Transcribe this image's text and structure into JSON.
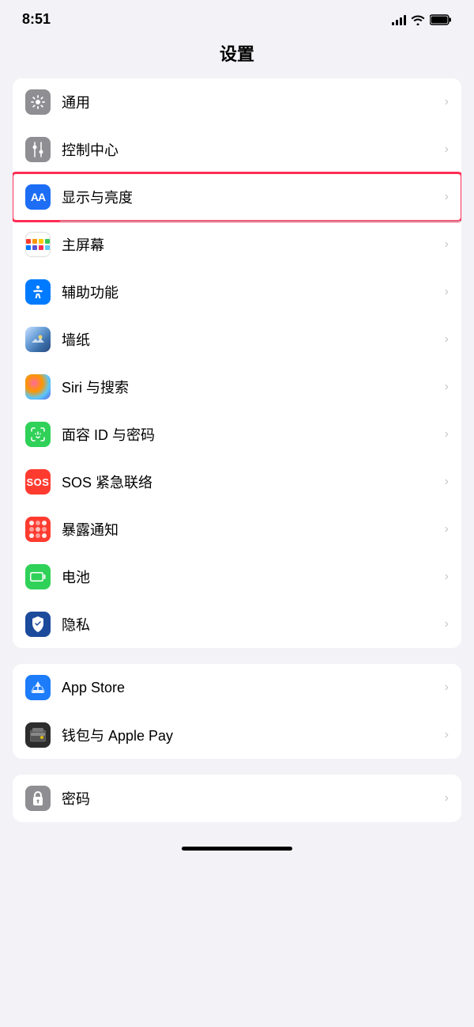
{
  "status": {
    "time": "8:51",
    "signal": "signal",
    "wifi": "wifi",
    "battery": "battery"
  },
  "page": {
    "title": "设置"
  },
  "group1": {
    "items": [
      {
        "id": "general",
        "label": "通用",
        "icon_type": "gray",
        "icon_symbol": "⚙",
        "highlighted": false
      },
      {
        "id": "control-center",
        "label": "控制中心",
        "icon_type": "gray-toggle",
        "icon_symbol": "toggle",
        "highlighted": false
      },
      {
        "id": "display",
        "label": "显示与亮度",
        "icon_type": "blue-aa",
        "icon_symbol": "AA",
        "highlighted": true
      },
      {
        "id": "home-screen",
        "label": "主屏幕",
        "icon_type": "colorful",
        "icon_symbol": "",
        "highlighted": false
      },
      {
        "id": "accessibility",
        "label": "辅助功能",
        "icon_type": "blue",
        "icon_symbol": "♿",
        "highlighted": false
      },
      {
        "id": "wallpaper",
        "label": "墙纸",
        "icon_type": "wallpaper",
        "icon_symbol": "✿",
        "highlighted": false
      },
      {
        "id": "siri",
        "label": "Siri 与搜索",
        "icon_type": "siri",
        "icon_symbol": "",
        "highlighted": false
      },
      {
        "id": "faceid",
        "label": "面容 ID 与密码",
        "icon_type": "faceid",
        "icon_symbol": "",
        "highlighted": false
      },
      {
        "id": "sos",
        "label": "SOS 紧急联络",
        "icon_type": "sos",
        "icon_symbol": "SOS",
        "highlighted": false
      },
      {
        "id": "exposure",
        "label": "暴露通知",
        "icon_type": "exposure",
        "icon_symbol": "",
        "highlighted": false
      },
      {
        "id": "battery",
        "label": "电池",
        "icon_type": "battery",
        "icon_symbol": "",
        "highlighted": false
      },
      {
        "id": "privacy",
        "label": "隐私",
        "icon_type": "privacy",
        "icon_symbol": "",
        "highlighted": false
      }
    ]
  },
  "group2": {
    "items": [
      {
        "id": "appstore",
        "label": "App Store",
        "icon_type": "appstore",
        "icon_symbol": "A",
        "highlighted": false
      },
      {
        "id": "wallet",
        "label": "钱包与 Apple Pay",
        "icon_type": "wallet",
        "icon_symbol": "",
        "highlighted": false
      }
    ]
  },
  "group3": {
    "items": [
      {
        "id": "password",
        "label": "密码",
        "icon_type": "password",
        "icon_symbol": "",
        "highlighted": false
      }
    ]
  },
  "chevron": "›"
}
